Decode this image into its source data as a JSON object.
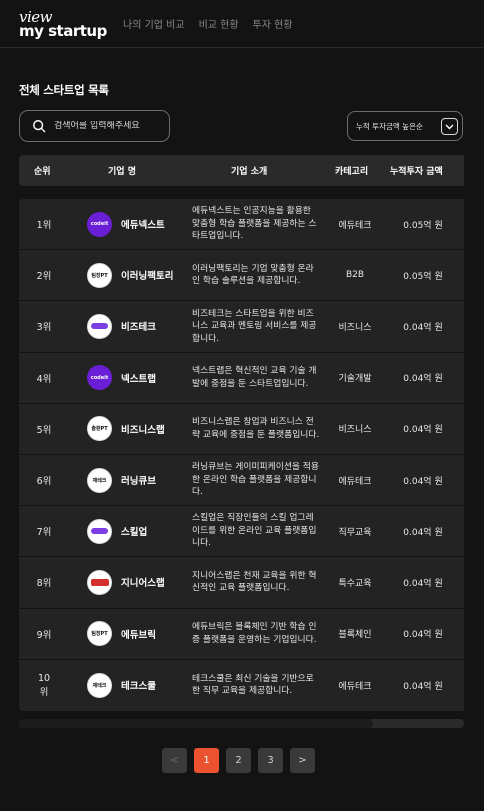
{
  "header": {
    "logo_line1": "view",
    "logo_line2": "my startup",
    "nav": [
      "나의 기업 비교",
      "비교 현황",
      "투자 현황"
    ]
  },
  "page_title": "전체 스타트업 목록",
  "search": {
    "placeholder": "검색어를 입력해주세요"
  },
  "sort": {
    "label": "누적 투자금액 높은순"
  },
  "table": {
    "columns": [
      "순위",
      "기업 명",
      "기업 소개",
      "카테고리",
      "누적투자 금액"
    ],
    "rows": [
      {
        "rank": "1위",
        "logo": "codeit",
        "name": "에듀넥스트",
        "desc": "에듀넥스트는 인공지능을 활용한 맞춤형 학습 플랫폼을 제공하는 스타트업입니다.",
        "category": "에듀테크",
        "amount": "0.05억 원"
      },
      {
        "rank": "2위",
        "logo": "팀장PT",
        "name": "이러닝팩토리",
        "desc": "이러닝팩토리는 기업 맞춤형 온라인 학습 솔루션을 제공합니다.",
        "category": "B2B",
        "amount": "0.05억 원"
      },
      {
        "rank": "3위",
        "logo": "purple",
        "name": "비즈테크",
        "desc": "비즈테크는 스타트업을 위한 비즈니스 교육과 멘토링 서비스를 제공합니다.",
        "category": "비즈니스",
        "amount": "0.04억 원"
      },
      {
        "rank": "4위",
        "logo": "codeit",
        "name": "넥스트랩",
        "desc": "넥스트랩은 혁신적인 교육 기술 개발에 중점을 둔 스타트업입니다.",
        "category": "기술개발",
        "amount": "0.04억 원"
      },
      {
        "rank": "5위",
        "logo": "출판PT",
        "name": "비즈니스랩",
        "desc": "비즈니스랩은 창업과 비즈니스 전략 교육에 중점을 둔 플랫폼입니다.",
        "category": "비즈니스",
        "amount": "0.04억 원"
      },
      {
        "rank": "6위",
        "logo": "재테크",
        "name": "러닝큐브",
        "desc": "러닝큐브는 게이미피케이션을 적용한 온라인 학습 플랫폼을 제공합니다.",
        "category": "에듀테크",
        "amount": "0.04억 원"
      },
      {
        "rank": "7위",
        "logo": "purple",
        "name": "스킬업",
        "desc": "스킬업은 직장인들의 스킬 업그레이드를 위한 온라인 교육 플랫폼입니다.",
        "category": "직무교육",
        "amount": "0.04억 원"
      },
      {
        "rank": "8위",
        "logo": "red",
        "name": "지니어스랩",
        "desc": "지니어스랩은 천재 교육을 위한 혁신적인 교육 플랫폼입니다.",
        "category": "특수교육",
        "amount": "0.04억 원"
      },
      {
        "rank": "9위",
        "logo": "팀장PT",
        "name": "에듀브릭",
        "desc": "에듀브릭은 블록체인 기반 학습 인증 플랫폼을 운영하는 기업입니다.",
        "category": "블록체인",
        "amount": "0.04억 원"
      },
      {
        "rank": "10위",
        "logo": "재테크",
        "name": "테크스쿨",
        "desc": "테크스쿨은 최신 기술을 기반으로 한 직무 교육을 제공합니다.",
        "category": "에듀테크",
        "amount": "0.04억 원"
      }
    ]
  },
  "pagination": {
    "prev": "<",
    "pages": [
      "1",
      "2",
      "3"
    ],
    "next": ">",
    "current": "1"
  },
  "colors": {
    "accent": "#eb5230",
    "background": "#131313",
    "row_bg": "#232323",
    "header_bg": "#2a2a2a"
  }
}
